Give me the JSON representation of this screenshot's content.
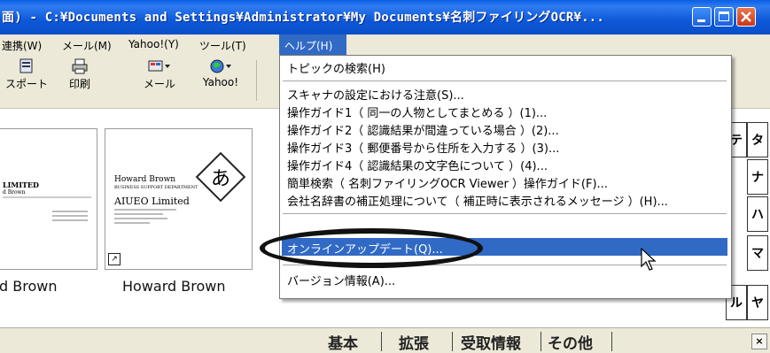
{
  "window": {
    "title": "面) - C:¥Documents and Settings¥Administrator¥My Documents¥名刺ファイリングOCR¥...",
    "icons": [
      "minimize-icon",
      "maximize-icon",
      "close-icon"
    ]
  },
  "menubar": {
    "items": [
      {
        "label": "連携(W)"
      },
      {
        "label": "メール(M)"
      },
      {
        "label": "Yahoo!(Y)"
      },
      {
        "label": "ツール(T)"
      },
      {
        "label": "ヘルプ(H)"
      }
    ]
  },
  "toolbar": {
    "items": [
      {
        "label": "スポート",
        "icon": "export-icon"
      },
      {
        "label": "印刷",
        "icon": "printer-icon"
      },
      {
        "label": "メール",
        "icon": "mail-icon"
      },
      {
        "label": "Yahoo!",
        "icon": "yahoo-globe-icon"
      }
    ]
  },
  "cards": [
    {
      "label": "d Brown",
      "company": "LIMITED",
      "name": "d Brown"
    },
    {
      "label": "Howard Brown",
      "name": "Howard Brown",
      "dept": "BUSINESS SUPPORT DEPARTMENT",
      "company": "AIUEO Limited",
      "badge": "あ"
    }
  ],
  "index_tabs": [
    "タ",
    "ナ",
    "ハ",
    "マ",
    "ヤ",
    "テ",
    "ル"
  ],
  "bottom_tabs": [
    "基本",
    "拡張",
    "受取情報",
    "その他"
  ],
  "help_menu": {
    "items": [
      {
        "label": "トピックの検索(H)"
      },
      {
        "label": "スキャナの設定における注意(S)..."
      },
      {
        "label": "操作ガイド1（ 同一の人物としてまとめる ）(1)..."
      },
      {
        "label": "操作ガイド2（ 認識結果が間違っている場合 ）(2)..."
      },
      {
        "label": "操作ガイド3（ 郵便番号から住所を入力する ）(3)..."
      },
      {
        "label": "操作ガイド4（ 認識結果の文字色について ）(4)..."
      },
      {
        "label": "簡単検索（ 名刺ファイリングOCR Viewer ）操作ガイド(F)..."
      },
      {
        "label": "会社名辞書の補正処理について（ 補正時に表示されるメッセージ ）(H)..."
      },
      {
        "label": "オンラインアップデート(Q)..."
      },
      {
        "label": "バージョン情報(A)..."
      }
    ]
  },
  "colors": {
    "titlebar": "#0a5fe6",
    "highlight": "#316ac5",
    "chrome": "#ece9d8"
  }
}
